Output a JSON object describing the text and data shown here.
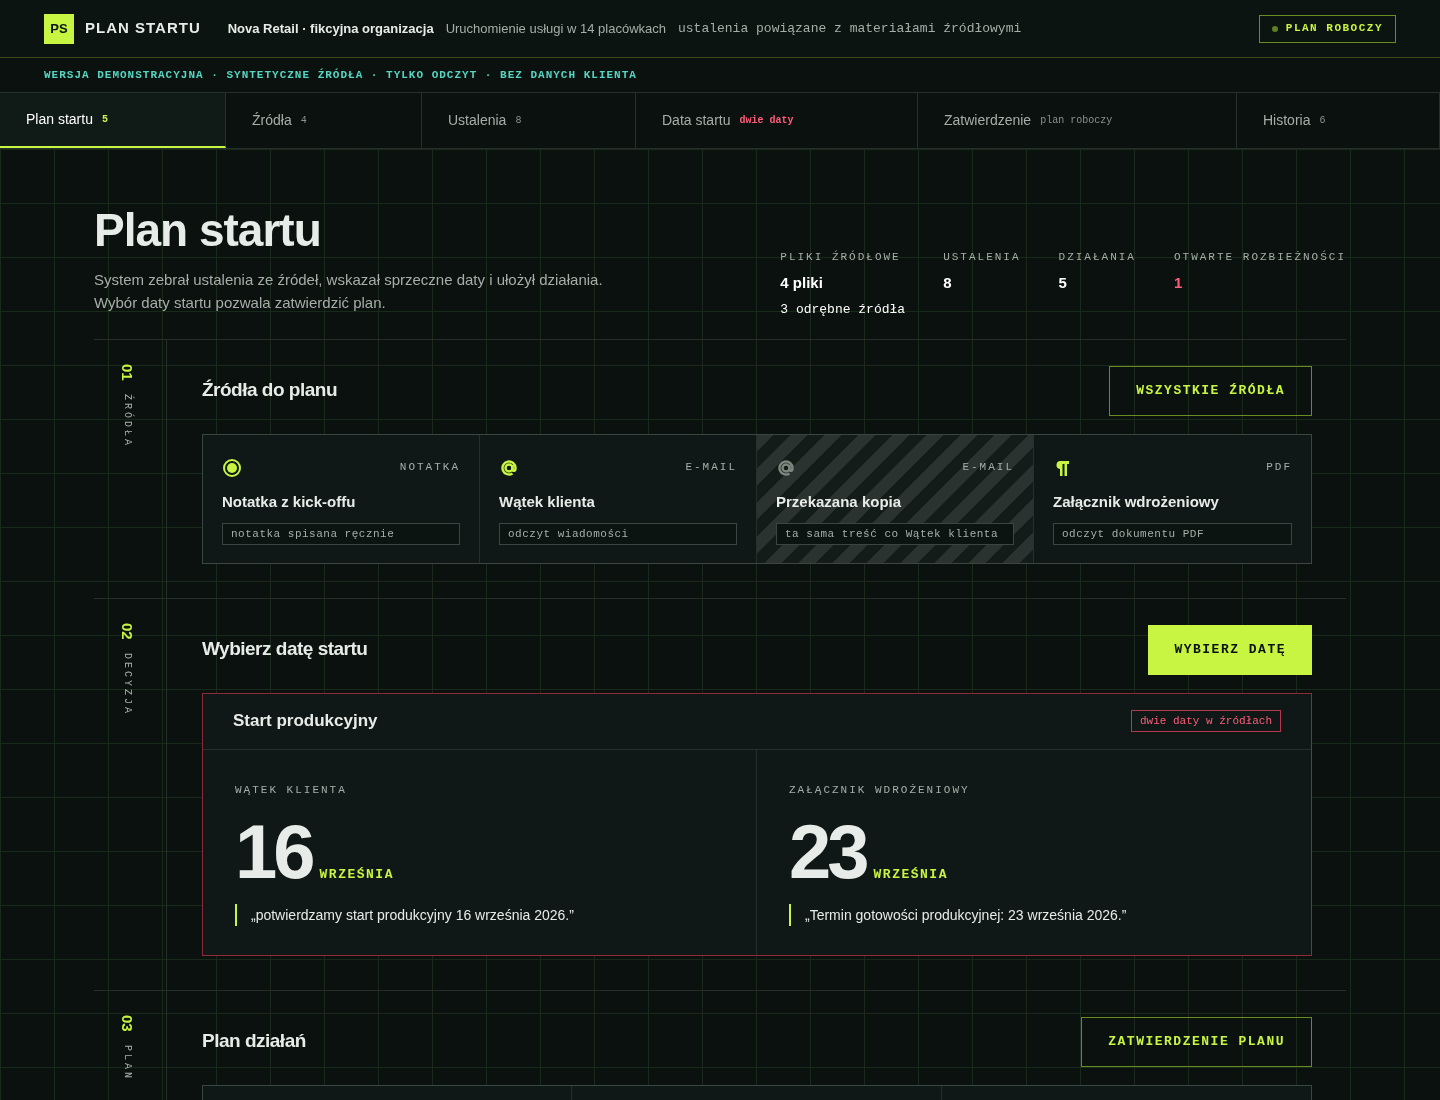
{
  "header": {
    "logo": "PS",
    "app_name": "PLAN STARTU",
    "org": "Nova Retail · fikcyjna organizacja",
    "project": "Uruchomienie usługi w 14 placówkach",
    "context": "ustalenia powiązane z materiałami źródłowymi",
    "status": "PLAN ROBOCZY"
  },
  "banner": "WERSJA DEMONSTRACYJNA · SYNTETYCZNE ŹRÓDŁA · TYLKO ODCZYT · BEZ DANYCH KLIENTA",
  "tabs": [
    {
      "label": "Plan startu",
      "badge": "5",
      "alert": false,
      "selected": true
    },
    {
      "label": "Źródła",
      "badge": "4",
      "alert": false,
      "selected": false
    },
    {
      "label": "Ustalenia",
      "badge": "8",
      "alert": false,
      "selected": false
    },
    {
      "label": "Data startu",
      "badge": "dwie daty",
      "alert": true,
      "selected": false
    },
    {
      "label": "Zatwierdzenie",
      "badge": "plan roboczy",
      "alert": false,
      "selected": false
    },
    {
      "label": "Historia",
      "badge": "6",
      "alert": false,
      "selected": false
    }
  ],
  "hero": {
    "title": "Plan startu",
    "lines": [
      "System zebrał ustalenia ze źródeł, wskazał sprzeczne daty i ułożył działania.",
      "Wybór daty startu pozwala zatwierdzić plan."
    ]
  },
  "stats": [
    {
      "label": "PLIKI ŹRÓDŁOWE",
      "value": "4 pliki",
      "note": "3 odrębne źródła",
      "alert": false
    },
    {
      "label": "USTALENIA",
      "value": "8",
      "alert": false
    },
    {
      "label": "DZIAŁANIA",
      "value": "5",
      "alert": false
    },
    {
      "label": "OTWARTE ROZBIEŻNOŚCI",
      "value": "1",
      "alert": true
    }
  ],
  "sections": [
    {
      "number": "01",
      "tag": "ŹRÓDŁA",
      "title": "Źródła do planu",
      "action": "WSZYSTKIE ŹRÓDŁA",
      "primary": false,
      "sources": [
        {
          "kind": "note",
          "type": "NOTATKA",
          "title": "Notatka z kick-offu",
          "method": "notatka spisana ręcznie",
          "duplicate": false
        },
        {
          "kind": "email",
          "type": "E-MAIL",
          "title": "Wątek klienta",
          "method": "odczyt wiadomości",
          "duplicate": false
        },
        {
          "kind": "email",
          "type": "E-MAIL",
          "title": "Przekazana kopia",
          "method": "ta sama treść co Wątek klienta",
          "duplicate": true
        },
        {
          "kind": "pdf",
          "type": "PDF",
          "title": "Załącznik wdrożeniowy",
          "method": "odczyt dokumentu PDF",
          "duplicate": false
        }
      ]
    },
    {
      "number": "02",
      "tag": "DECYZJA",
      "title": "Wybierz datę startu",
      "action": "WYBIERZ DATĘ",
      "primary": true,
      "decision": {
        "title": "Start produkcyjny",
        "flag": "dwie daty w źródłach",
        "options": [
          {
            "source": "WĄTEK KLIENTA",
            "day": "16",
            "month": "WRZEŚNIA",
            "quote": "„potwierdzamy start produkcyjny 16 września 2026.”"
          },
          {
            "source": "ZAŁĄCZNIK WDROŻENIOWY",
            "day": "23",
            "month": "WRZEŚNIA",
            "quote": "„Termin gotowości produkcyjnej: 23 września 2026.”"
          }
        ]
      }
    },
    {
      "number": "03",
      "tag": "PLAN",
      "title": "Plan działań",
      "action": "ZATWIERDZENIE PLANU",
      "primary": false,
      "board": true
    }
  ]
}
